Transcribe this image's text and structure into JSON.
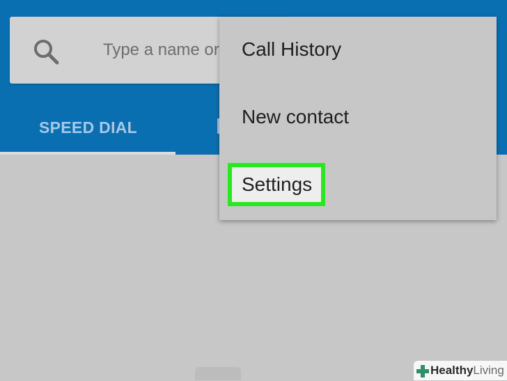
{
  "search": {
    "placeholder": "Type a name or"
  },
  "tabs": [
    {
      "label": "SPEED DIAL",
      "selected": true
    }
  ],
  "menu": {
    "items": [
      {
        "label": "Call History"
      },
      {
        "label": "New contact"
      },
      {
        "label": "Settings",
        "highlighted": true
      }
    ]
  },
  "watermark": {
    "brand_bold": "Healthy",
    "brand_light": "Living"
  },
  "colors": {
    "app_bar": "#0a6fb0",
    "highlight_border": "#29e81f",
    "background": "#c7c7c7"
  },
  "icons": {
    "search": "search-icon",
    "watermark_logo": "cross-icon"
  }
}
